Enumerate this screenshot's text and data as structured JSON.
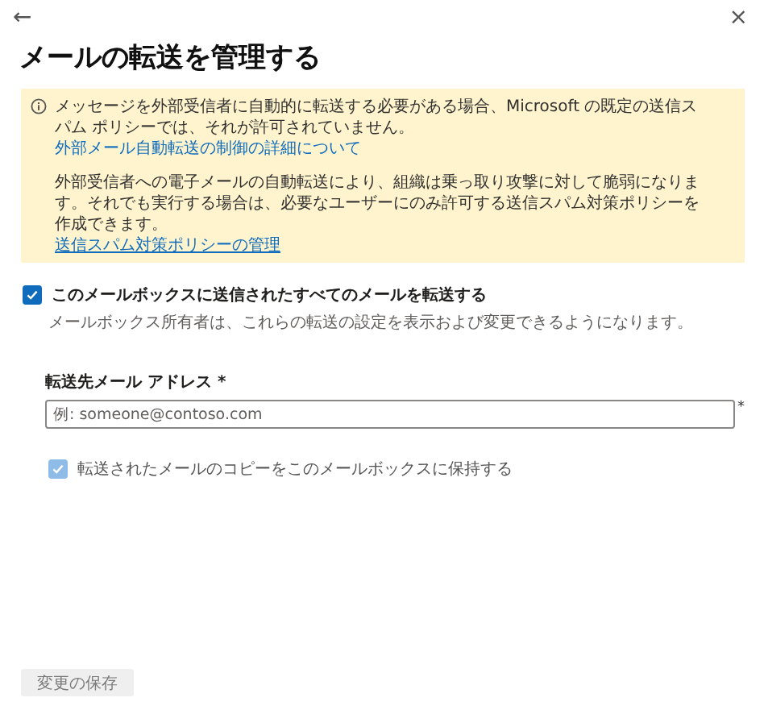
{
  "header": {
    "back": "←",
    "close": "×",
    "title": "メールの転送を管理する"
  },
  "banner": {
    "message": "メッセージを外部受信者に自動的に転送する必要がある場合、Microsoft の既定の送信スパム ポリシーでは、それが許可されていません。",
    "link": "外部メール自動転送の制御の詳細について",
    "note": "外部受信者への電子メールの自動転送により、組織は乗っ取り攻撃に対して脆弱になります。それでも実行する場合は、必要なユーザーにのみ許可する送信スパム対策ポリシーを作成できます。",
    "note_link": "送信スパム対策ポリシーの管理"
  },
  "forward": {
    "label": "このメールボックスに送信されたすべてのメールを転送する",
    "checked": true,
    "disabled": false,
    "description": "メールボックス所有者は、これらの転送の設定を表示および変更できるようになります。"
  },
  "address": {
    "label": "転送先メール アドレス *",
    "placeholder": "例: someone@contoso.com",
    "required_mark": "*"
  },
  "keep_copy": {
    "label": "転送されたメールのコピーをこのメールボックスに保持する",
    "checked": true,
    "disabled": true
  },
  "save": {
    "label": "変更の保存",
    "disabled": true
  }
}
